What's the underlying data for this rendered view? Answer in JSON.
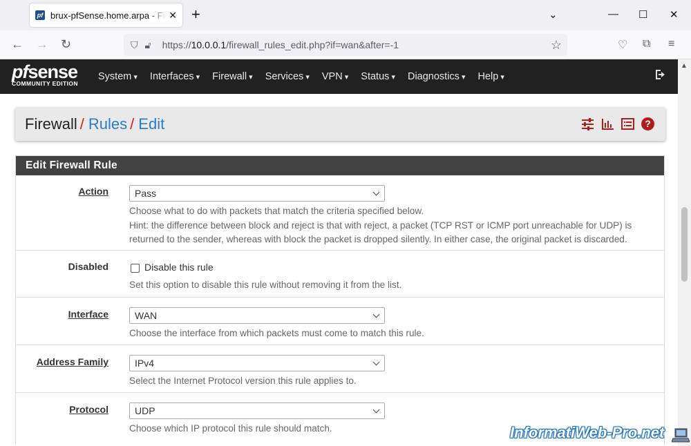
{
  "browser": {
    "tab_title": "brux-pfSense.home.arpa - Firewall: Rules: Edit",
    "tab_favicon": "pf",
    "url_prefix": "https://",
    "url_host": "10.0.0.1",
    "url_path": "/firewall_rules_edit.php?if=wan&after=-1"
  },
  "pfsense": {
    "logo_main_pf": "pf",
    "logo_main_rest": "sense",
    "logo_sub": "COMMUNITY EDITION",
    "menu": [
      "System",
      "Interfaces",
      "Firewall",
      "Services",
      "VPN",
      "Status",
      "Diagnostics",
      "Help"
    ]
  },
  "breadcrumb": {
    "part1": "Firewall",
    "part2": "Rules",
    "part3": "Edit",
    "separator": "/"
  },
  "panel": {
    "title": "Edit Firewall Rule",
    "fields": {
      "action": {
        "label": "Action",
        "value": "Pass",
        "help1": "Choose what to do with packets that match the criteria specified below.",
        "help2": "Hint: the difference between block and reject is that with reject, a packet (TCP RST or ICMP port unreachable for UDP) is returned to the sender, whereas with block the packet is dropped silently. In either case, the original packet is discarded."
      },
      "disabled": {
        "label": "Disabled",
        "checkbox_label": "Disable this rule",
        "help": "Set this option to disable this rule without removing it from the list."
      },
      "interface": {
        "label": "Interface",
        "value": "WAN",
        "help": "Choose the interface from which packets must come to match this rule."
      },
      "address_family": {
        "label": "Address Family",
        "value": "IPv4",
        "help": "Select the Internet Protocol version this rule applies to."
      },
      "protocol": {
        "label": "Protocol",
        "value": "UDP",
        "help": "Choose which IP protocol this rule should match."
      }
    }
  },
  "watermark": "InformatiWeb-Pro.net",
  "colors": {
    "header_bg": "#212121",
    "accent_red": "#b01c1c",
    "link_blue": "#2a7dc7",
    "panel_heading": "#424242"
  },
  "icons": [
    "sliders-icon",
    "bar-chart-icon",
    "list-icon",
    "help-circle-icon",
    "logout-icon"
  ]
}
